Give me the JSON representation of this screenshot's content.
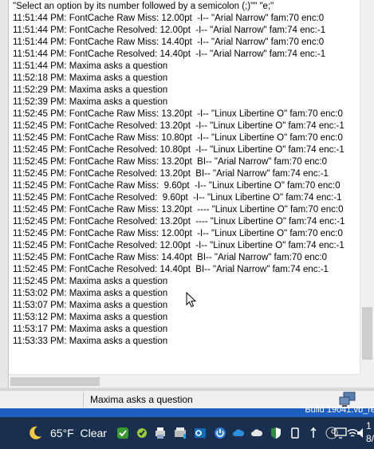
{
  "log": {
    "lines": [
      "\"Select an option by its number followed by a semicolon (;)\"\" \"e;\"",
      "11:51:44 PM: FontCache Raw Miss: 12.00pt  -I-- \"Arial Narrow\" fam:70 enc:0",
      "11:51:44 PM: FontCache Resolved: 12.00pt  -I-- \"Arial Narrow\" fam:74 enc:-1",
      "11:51:44 PM: FontCache Raw Miss: 14.40pt  -I-- \"Arial Narrow\" fam:70 enc:0",
      "11:51:44 PM: FontCache Resolved: 14.40pt  -I-- \"Arial Narrow\" fam:74 enc:-1",
      "11:51:44 PM: Maxima asks a question",
      "11:52:18 PM: Maxima asks a question",
      "11:52:29 PM: Maxima asks a question",
      "11:52:39 PM: Maxima asks a question",
      "11:52:45 PM: FontCache Raw Miss: 13.20pt  -I-- \"Linux Libertine O\" fam:70 enc:0",
      "11:52:45 PM: FontCache Resolved: 13.20pt  -I-- \"Linux Libertine O\" fam:74 enc:-1",
      "11:52:45 PM: FontCache Raw Miss: 10.80pt  -I-- \"Linux Libertine O\" fam:70 enc:0",
      "11:52:45 PM: FontCache Resolved: 10.80pt  -I-- \"Linux Libertine O\" fam:74 enc:-1",
      "11:52:45 PM: FontCache Raw Miss: 13.20pt  BI-- \"Arial Narrow\" fam:70 enc:0",
      "11:52:45 PM: FontCache Resolved: 13.20pt  BI-- \"Arial Narrow\" fam:74 enc:-1",
      "11:52:45 PM: FontCache Raw Miss:  9.60pt  -I-- \"Linux Libertine O\" fam:70 enc:0",
      "11:52:45 PM: FontCache Resolved:  9.60pt  -I-- \"Linux Libertine O\" fam:74 enc:-1",
      "11:52:45 PM: FontCache Raw Miss: 13.20pt  ---- \"Linux Libertine O\" fam:70 enc:0",
      "11:52:45 PM: FontCache Resolved: 13.20pt  ---- \"Linux Libertine O\" fam:74 enc:-1",
      "11:52:45 PM: FontCache Raw Miss: 12.00pt  -I-- \"Linux Libertine O\" fam:70 enc:0",
      "11:52:45 PM: FontCache Resolved: 12.00pt  -I-- \"Linux Libertine O\" fam:74 enc:-1",
      "11:52:45 PM: FontCache Raw Miss: 14.40pt  BI-- \"Arial Narrow\" fam:70 enc:0",
      "11:52:45 PM: FontCache Resolved: 14.40pt  BI-- \"Arial Narrow\" fam:74 enc:-1",
      "11:52:45 PM: Maxima asks a question",
      "11:53:02 PM: Maxima asks a question",
      "11:53:07 PM: Maxima asks a question",
      "11:53:12 PM: Maxima asks a question",
      "11:53:17 PM: Maxima asks a question",
      "11:53:33 PM: Maxima asks a question"
    ]
  },
  "statusbar": {
    "message": "Maxima asks a question"
  },
  "build": {
    "label": "Build 19041.vb_re"
  },
  "taskbar": {
    "weather": "65°F  Clear",
    "clock_top": "1",
    "clock_bottom": "8/"
  },
  "icons": {
    "weather": "moon-icon",
    "network": "network-computer-icon",
    "tray": [
      "shield-check-icon",
      "tools-icon",
      "printer-icon",
      "outlook-icon",
      "power-icon",
      "cloud-icon",
      "cloud-icon",
      "security-shield-icon",
      "eject-icon",
      "usb-icon",
      "steam-icon",
      "display-icon",
      "wifi-icon",
      "volume-icon"
    ]
  },
  "colors": {
    "taskbar": "#1a2f4e",
    "build_bar": "#1f5fbf"
  }
}
